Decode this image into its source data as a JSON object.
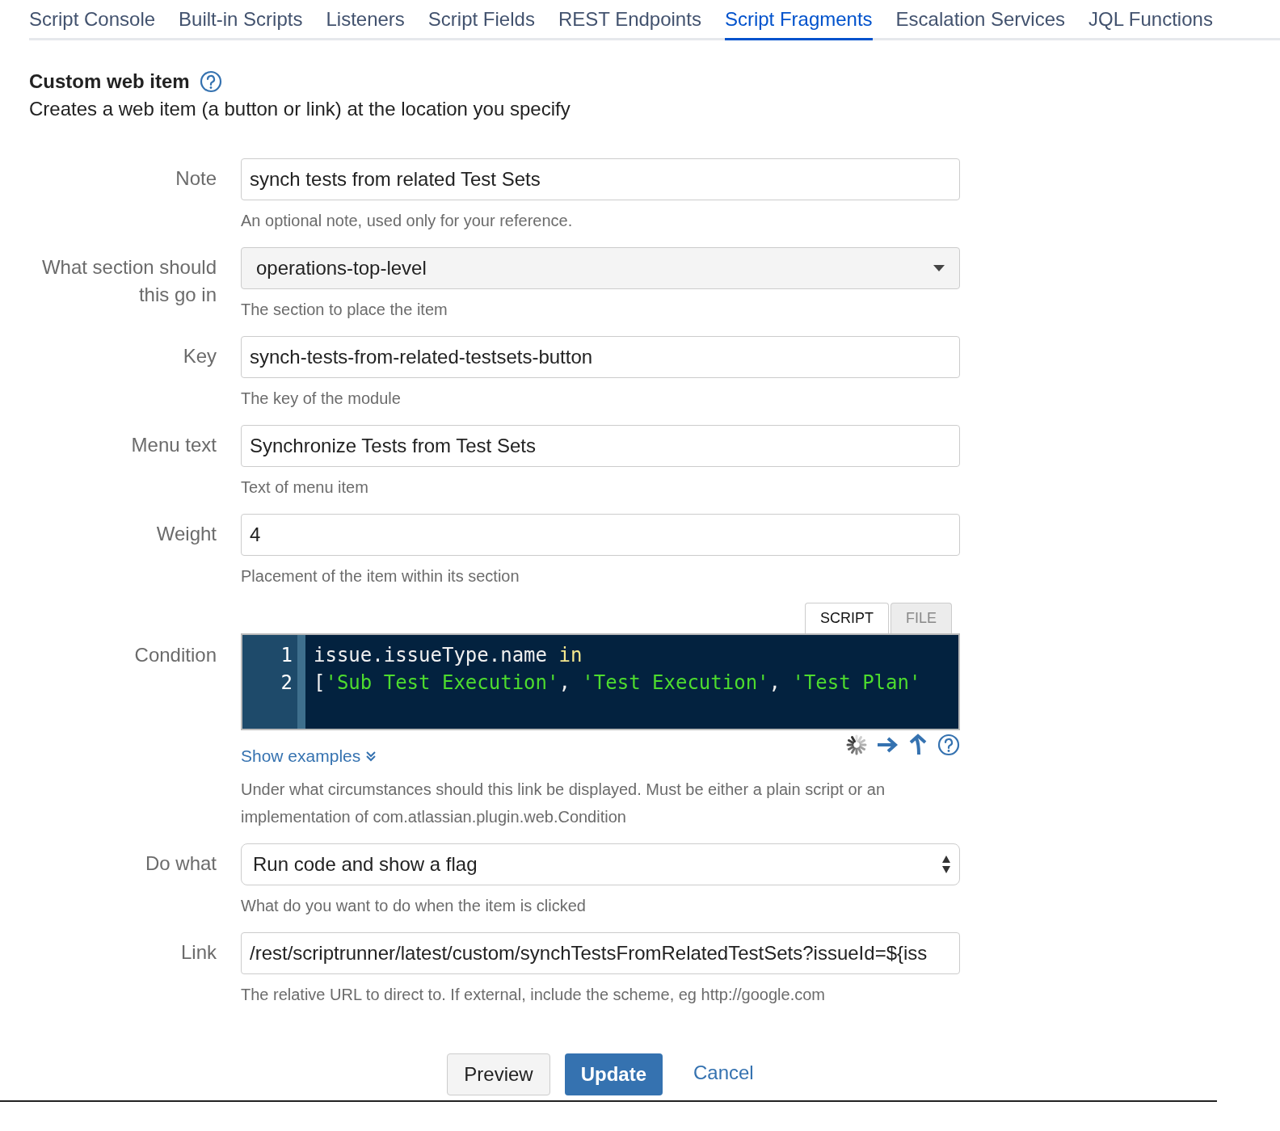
{
  "tabs": [
    {
      "label": "Script Console",
      "selected": false
    },
    {
      "label": "Built-in Scripts",
      "selected": false
    },
    {
      "label": "Listeners",
      "selected": false
    },
    {
      "label": "Script Fields",
      "selected": false
    },
    {
      "label": "REST Endpoints",
      "selected": false
    },
    {
      "label": "Script Fragments",
      "selected": true
    },
    {
      "label": "Escalation Services",
      "selected": false
    },
    {
      "label": "JQL Functions",
      "selected": false
    }
  ],
  "heading": {
    "title": "Custom web item",
    "description": "Creates a web item (a button or link) at the location you specify"
  },
  "fields": [
    {
      "kind": "text",
      "label": "Note",
      "value": "synch tests from related Test Sets",
      "help": [
        "An optional note, used only for your reference."
      ]
    },
    {
      "kind": "select",
      "label": "What section should this go in",
      "value": "operations-top-level",
      "help": [
        "The section to place the item"
      ]
    },
    {
      "kind": "text",
      "label": "Key",
      "value": "synch-tests-from-related-testsets-button",
      "help": [
        "The key of the module"
      ]
    },
    {
      "kind": "text",
      "label": "Menu text",
      "value": "Synchronize Tests from Test Sets",
      "help": [
        "Text of menu item"
      ]
    },
    {
      "kind": "text",
      "label": "Weight",
      "value": "4",
      "help": [
        "Placement of the item within its section"
      ]
    },
    {
      "kind": "code",
      "label": "Condition",
      "tabs": [
        {
          "label": "SCRIPT",
          "selected": true
        },
        {
          "label": "FILE",
          "selected": false
        }
      ],
      "lines": [
        {
          "number": "1",
          "tokens": [
            {
              "kind": "plain",
              "text": "issue.issueType.name "
            },
            {
              "kind": "keyword",
              "text": "in"
            }
          ]
        },
        {
          "number": "2",
          "tokens": [
            {
              "kind": "plain",
              "text": "["
            },
            {
              "kind": "string",
              "text": "'Sub Test Execution'"
            },
            {
              "kind": "plain",
              "text": ", "
            },
            {
              "kind": "string",
              "text": "'Test Execution'"
            },
            {
              "kind": "plain",
              "text": ", "
            },
            {
              "kind": "string",
              "text": "'Test Plan'"
            }
          ]
        }
      ],
      "link": "Show examples",
      "help": [
        "Under what circumstances should this link be displayed. Must be either a plain script or an",
        "implementation of com.atlassian.plugin.web.Condition"
      ]
    },
    {
      "kind": "native-select",
      "label": "Do what",
      "value": "Run code and show a flag",
      "help": [
        "What do you want to do when the item is clicked"
      ]
    },
    {
      "kind": "text",
      "label": "Link",
      "value": "/rest/scriptrunner/latest/custom/synchTestsFromRelatedTestSets?issueId=${iss",
      "help": [
        "The relative URL to direct to. If external, include the scheme, eg http://google.com"
      ]
    }
  ],
  "buttons": [
    {
      "kind": "secondary",
      "label": "Preview"
    },
    {
      "kind": "primary",
      "label": "Update"
    },
    {
      "kind": "link",
      "label": "Cancel"
    }
  ]
}
